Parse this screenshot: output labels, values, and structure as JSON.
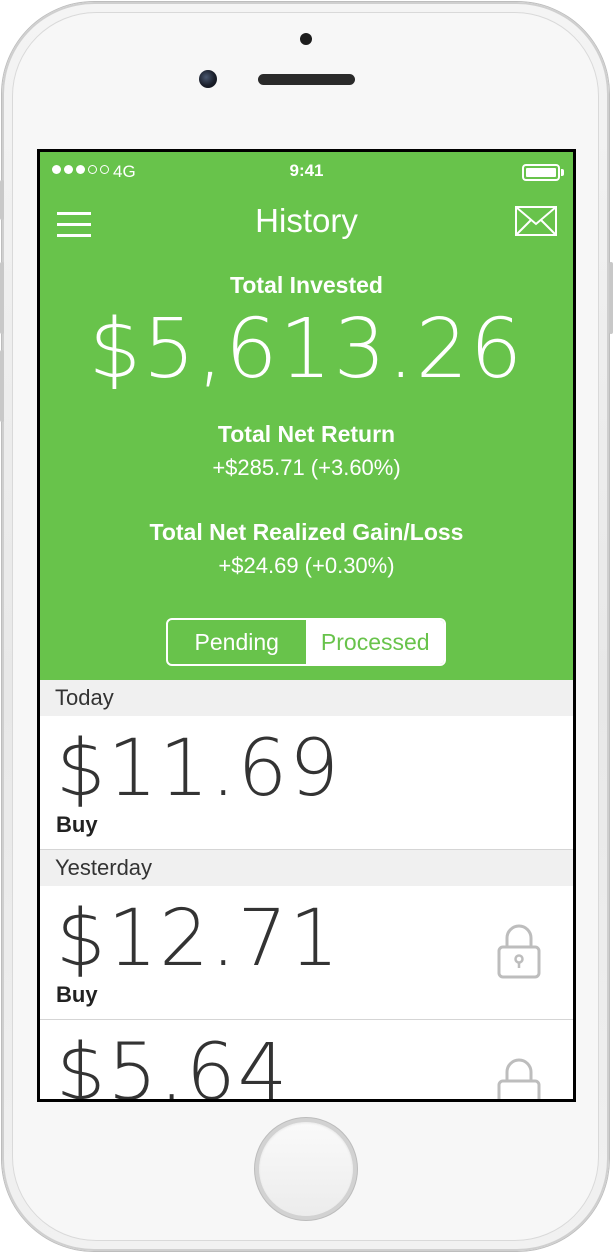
{
  "status_bar": {
    "signal_full": 3,
    "signal_total": 5,
    "carrier": "4G",
    "time": "9:41"
  },
  "header": {
    "title": "History",
    "menu_icon": "hamburger-menu-icon",
    "mail_icon": "envelope-icon",
    "bg_color": "#68c34b"
  },
  "summary": {
    "total_invested_label": "Total Invested",
    "total_invested_value": "$5,613.26",
    "net_return_label": "Total Net Return",
    "net_return_value": "+$285.71 (+3.60%)",
    "realized_label": "Total Net Realized Gain/Loss",
    "realized_value": "+$24.69 (+0.30%)"
  },
  "segments": {
    "pending_label": "Pending",
    "processed_label": "Processed",
    "selected": "Processed"
  },
  "history": {
    "today_header": "Today",
    "yesterday_header": "Yesterday",
    "items": [
      {
        "amount": "$11.69",
        "type": "Buy",
        "locked": false
      },
      {
        "amount": "$12.71",
        "type": "Buy",
        "locked": true
      },
      {
        "amount": "$5.64",
        "type": "",
        "locked": true
      }
    ]
  }
}
